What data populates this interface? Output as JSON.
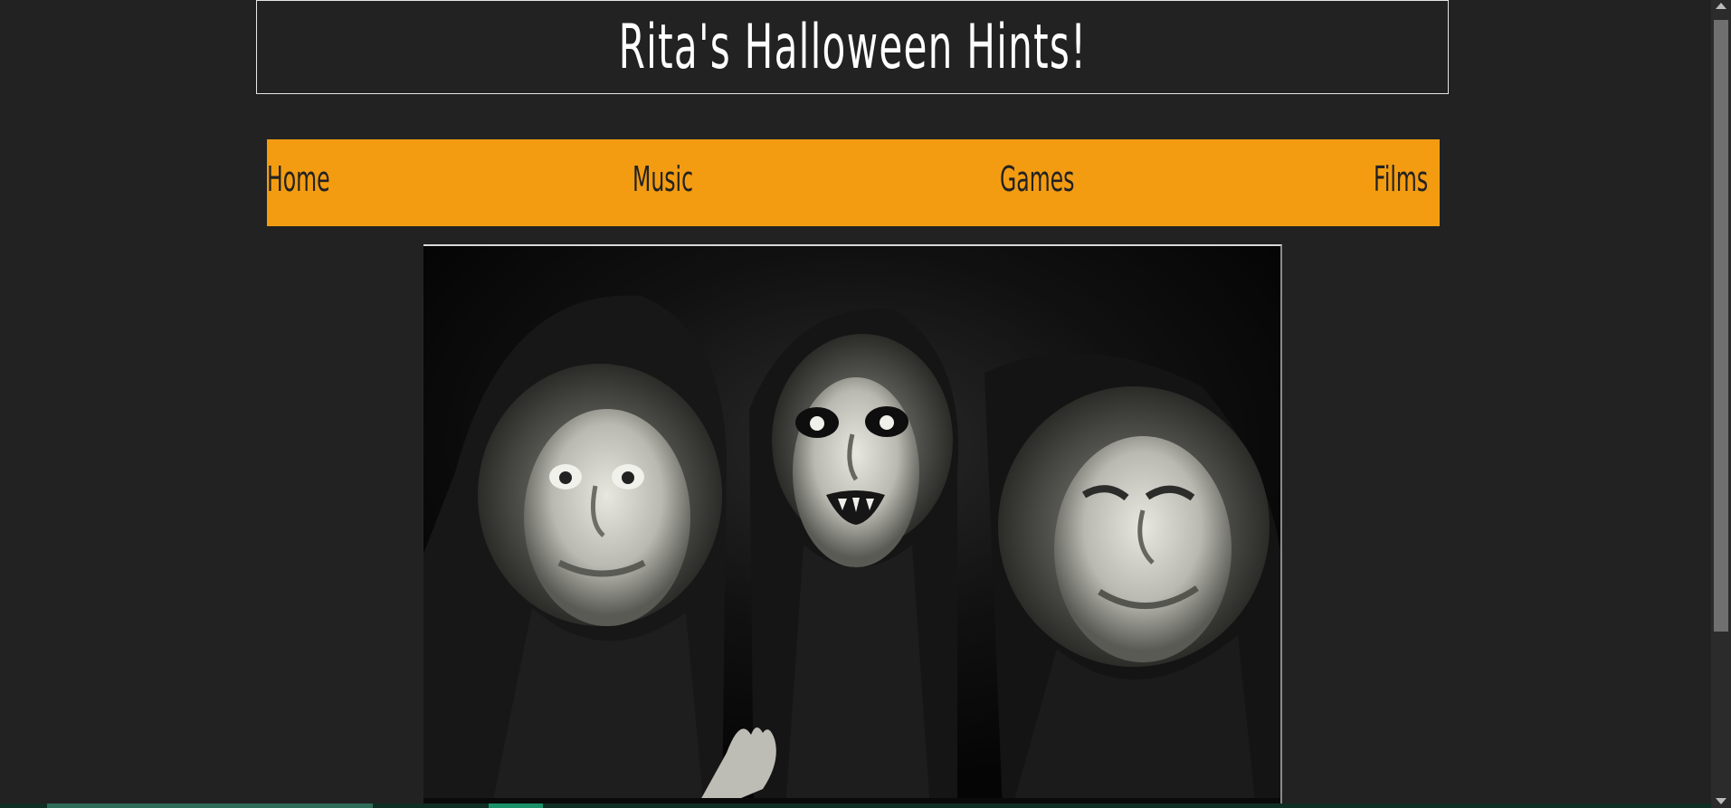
{
  "header": {
    "title": "Rita's Halloween Hints!"
  },
  "nav": {
    "items": [
      {
        "label": "Home"
      },
      {
        "label": "Music"
      },
      {
        "label": "Games"
      },
      {
        "label": "Films"
      }
    ]
  },
  "colors": {
    "page_background": "#222222",
    "nav_background": "#f39c12",
    "title_text": "#ffffff",
    "nav_text": "#222222"
  }
}
